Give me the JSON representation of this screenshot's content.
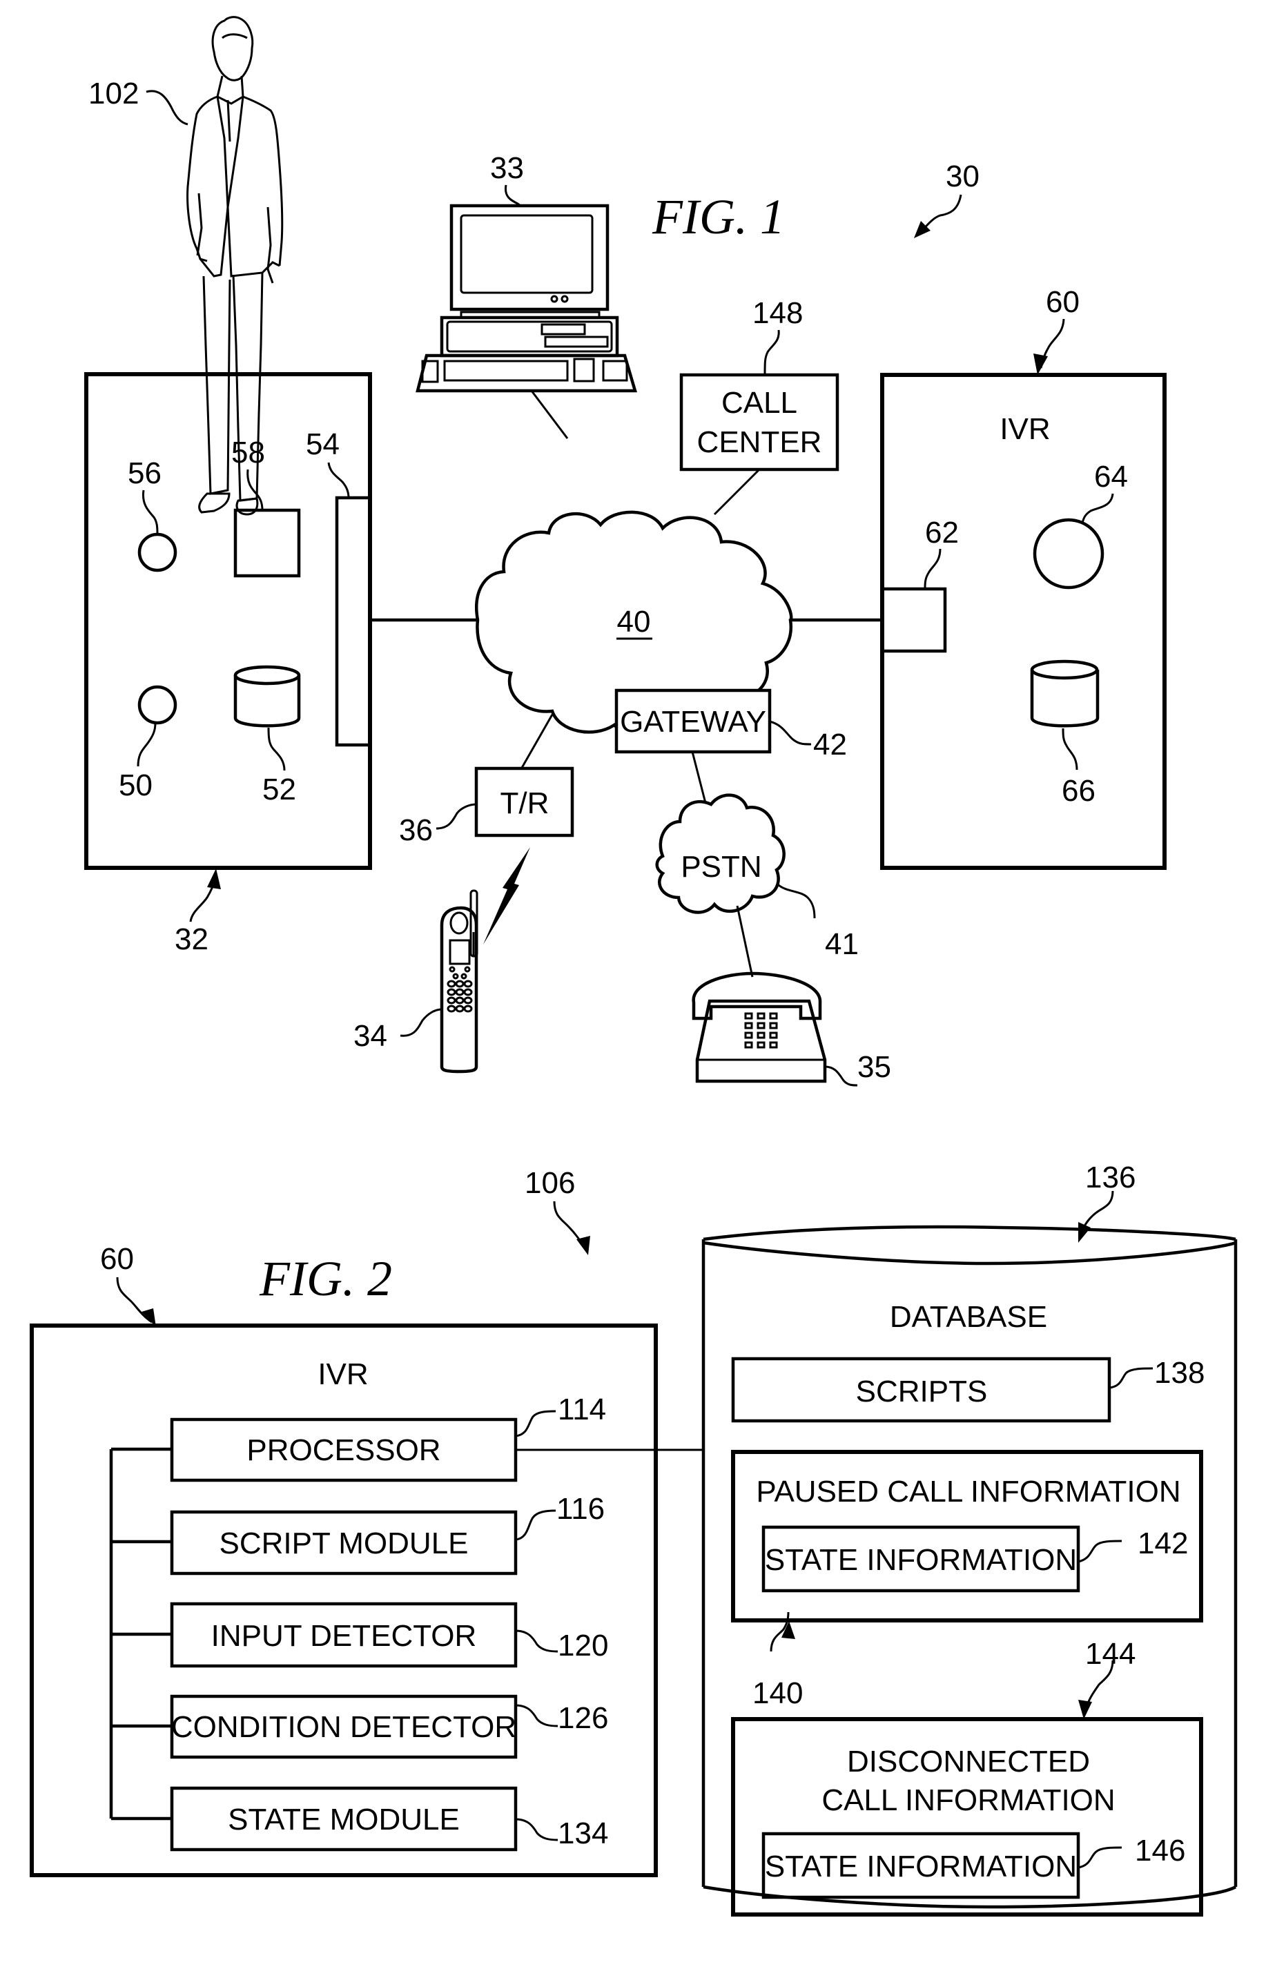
{
  "fig1": {
    "title": "FIG. 1",
    "system_ref": "30",
    "person": {
      "ref": "102",
      "icon": "person-icon"
    },
    "computer": {
      "ref": "33",
      "icon": "desktop-computer-icon"
    },
    "device_32": {
      "ref": "32",
      "components": [
        {
          "ref": "56",
          "shape": "circle"
        },
        {
          "ref": "58",
          "shape": "square"
        },
        {
          "ref": "54",
          "shape": "interface-bar"
        },
        {
          "ref": "50",
          "shape": "circle"
        },
        {
          "ref": "52",
          "shape": "cylinder"
        }
      ]
    },
    "call_center": {
      "ref": "148",
      "line1": "CALL",
      "line2": "CENTER"
    },
    "network": {
      "ref": "40"
    },
    "gateway": {
      "ref": "42",
      "label": "GATEWAY"
    },
    "transceiver": {
      "ref": "36",
      "label": "T/R"
    },
    "pstn": {
      "ref": "41",
      "label": "PSTN"
    },
    "cell_phone": {
      "ref": "34",
      "icon": "cell-phone-icon"
    },
    "desk_phone": {
      "ref": "35",
      "icon": "desk-phone-icon"
    },
    "ivr": {
      "ref": "60",
      "label": "IVR",
      "components": [
        {
          "ref": "62",
          "shape": "square"
        },
        {
          "ref": "64",
          "shape": "circle"
        },
        {
          "ref": "66",
          "shape": "cylinder"
        }
      ]
    }
  },
  "fig2": {
    "title": "FIG. 2",
    "system_ref": "106",
    "ivr": {
      "ref": "60",
      "label": "IVR",
      "modules": [
        {
          "ref": "114",
          "label": "PROCESSOR"
        },
        {
          "ref": "116",
          "label": "SCRIPT MODULE"
        },
        {
          "ref": "120",
          "label": "INPUT DETECTOR"
        },
        {
          "ref": "126",
          "label": "CONDITION DETECTOR"
        },
        {
          "ref": "134",
          "label": "STATE MODULE"
        }
      ]
    },
    "database": {
      "ref": "136",
      "label": "DATABASE",
      "scripts": {
        "ref": "138",
        "label": "SCRIPTS"
      },
      "paused": {
        "ref": "140",
        "label": "PAUSED CALL INFORMATION",
        "state": {
          "ref": "142",
          "label": "STATE INFORMATION"
        }
      },
      "disconnected": {
        "ref": "144",
        "line1": "DISCONNECTED",
        "line2": "CALL INFORMATION",
        "state": {
          "ref": "146",
          "label": "STATE INFORMATION"
        }
      }
    }
  }
}
